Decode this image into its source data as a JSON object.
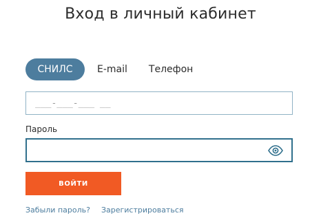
{
  "page": {
    "title": "Вход в личный кабинет"
  },
  "tabs": [
    {
      "label": "СНИЛС",
      "active": true
    },
    {
      "label": "E-mail",
      "active": false
    },
    {
      "label": "Телефон",
      "active": false
    }
  ],
  "snils": {
    "placeholder": "___-___-___ __",
    "value": ""
  },
  "password": {
    "label": "Пароль",
    "value": "",
    "toggle_icon": "eye-icon"
  },
  "login_button": {
    "label": "ВОЙТИ"
  },
  "links": {
    "forgot_password": "Забыли пароль?",
    "register": "Зарегистрироваться"
  },
  "colors": {
    "active_tab": "#4d7d9e",
    "button": "#f15a24",
    "link": "#4d7d9e",
    "focused_border": "#2f6f8c",
    "input_border": "#8fb2c5"
  }
}
